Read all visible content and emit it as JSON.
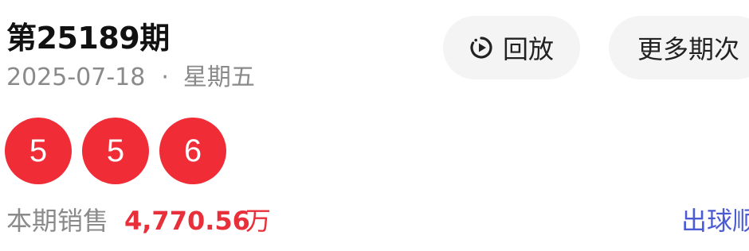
{
  "header": {
    "issue_title": "第25189期",
    "date": "2025-07-18",
    "separator": "·",
    "weekday": "星期五"
  },
  "actions": {
    "replay_label": "回放",
    "replay_icon": "replay-icon",
    "more_issues_label": "更多期次"
  },
  "draw": {
    "balls": [
      "5",
      "5",
      "6"
    ],
    "ball_color": "#f02d36"
  },
  "sales": {
    "label": "本期销售",
    "amount": "4,770.56",
    "unit": "万",
    "amount_color": "#e8303a"
  },
  "links": {
    "ball_order_label": "出球顺序"
  }
}
